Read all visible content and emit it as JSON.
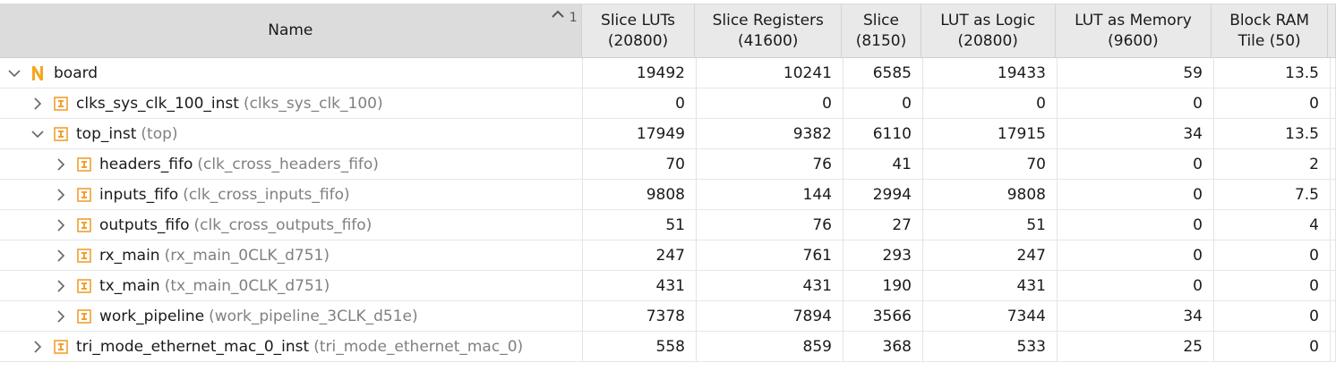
{
  "header": {
    "name": "Name",
    "sort_index": "1",
    "columns": [
      {
        "line1": "Slice LUTs",
        "line2": "(20800)"
      },
      {
        "line1": "Slice Registers",
        "line2": "(41600)"
      },
      {
        "line1": "Slice",
        "line2": "(8150)"
      },
      {
        "line1": "LUT as Logic",
        "line2": "(20800)"
      },
      {
        "line1": "LUT as Memory",
        "line2": "(9600)"
      },
      {
        "line1": "Block RAM",
        "line2": "Tile (50)"
      }
    ]
  },
  "colors": {
    "module_icon": "#f0a030",
    "n_icon": "#f5a623",
    "module_name_text": "#808080"
  },
  "rows": [
    {
      "inst": "board",
      "module": "",
      "icon": "netlist-n-icon",
      "expander": "expanded",
      "level": 0,
      "values": [
        "19492",
        "10241",
        "6585",
        "19433",
        "59",
        "13.5"
      ]
    },
    {
      "inst": "clks_sys_clk_100_inst",
      "module": "(clks_sys_clk_100)",
      "icon": "module-icon",
      "expander": "collapsed",
      "level": 1,
      "values": [
        "0",
        "0",
        "0",
        "0",
        "0",
        "0"
      ]
    },
    {
      "inst": "top_inst",
      "module": "(top)",
      "icon": "module-icon",
      "expander": "expanded",
      "level": 1,
      "values": [
        "17949",
        "9382",
        "6110",
        "17915",
        "34",
        "13.5"
      ]
    },
    {
      "inst": "headers_fifo",
      "module": "(clk_cross_headers_fifo)",
      "icon": "module-icon",
      "expander": "collapsed",
      "level": 2,
      "values": [
        "70",
        "76",
        "41",
        "70",
        "0",
        "2"
      ]
    },
    {
      "inst": "inputs_fifo",
      "module": "(clk_cross_inputs_fifo)",
      "icon": "module-icon",
      "expander": "collapsed",
      "level": 2,
      "values": [
        "9808",
        "144",
        "2994",
        "9808",
        "0",
        "7.5"
      ]
    },
    {
      "inst": "outputs_fifo",
      "module": "(clk_cross_outputs_fifo)",
      "icon": "module-icon",
      "expander": "collapsed",
      "level": 2,
      "values": [
        "51",
        "76",
        "27",
        "51",
        "0",
        "4"
      ]
    },
    {
      "inst": "rx_main",
      "module": "(rx_main_0CLK_d751)",
      "icon": "module-icon",
      "expander": "collapsed",
      "level": 2,
      "values": [
        "247",
        "761",
        "293",
        "247",
        "0",
        "0"
      ]
    },
    {
      "inst": "tx_main",
      "module": "(tx_main_0CLK_d751)",
      "icon": "module-icon",
      "expander": "collapsed",
      "level": 2,
      "values": [
        "431",
        "431",
        "190",
        "431",
        "0",
        "0"
      ]
    },
    {
      "inst": "work_pipeline",
      "module": "(work_pipeline_3CLK_d51e)",
      "icon": "module-icon",
      "expander": "collapsed",
      "level": 2,
      "values": [
        "7378",
        "7894",
        "3566",
        "7344",
        "34",
        "0"
      ]
    },
    {
      "inst": "tri_mode_ethernet_mac_0_inst",
      "module": "(tri_mode_ethernet_mac_0)",
      "icon": "module-icon",
      "expander": "collapsed",
      "level": 1,
      "values": [
        "558",
        "859",
        "368",
        "533",
        "25",
        "0"
      ]
    }
  ]
}
